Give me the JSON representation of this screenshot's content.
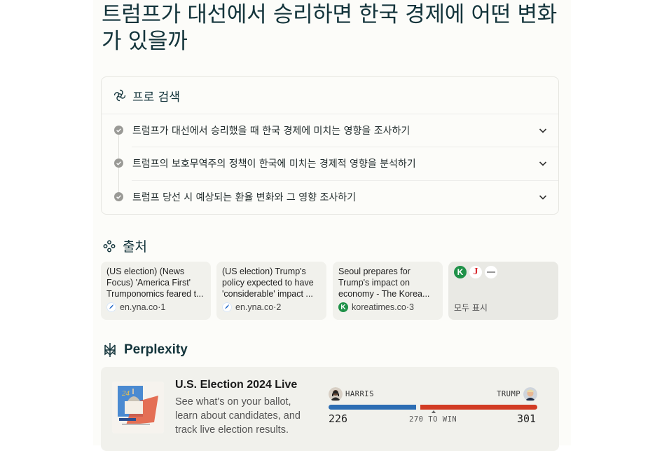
{
  "page": {
    "title": "트럼프가 대선에서 승리하면 한국 경제에 어떤 변화가 있을까"
  },
  "pro_search": {
    "header": "프로 검색",
    "steps": [
      {
        "label": "트럼프가 대선에서 승리했을 때 한국 경제에 미치는 영향을 조사하기"
      },
      {
        "label": "트럼프의 보호무역주의 정책이 한국에 미치는 경제적 영향을 분석하기"
      },
      {
        "label": "트럼프 당선 시 예상되는 환율 변화와 그 영향 조사하기"
      }
    ]
  },
  "sources": {
    "header": "출처",
    "items": [
      {
        "title": "(US election) (News Focus) 'America First' Trumponomics feared t...",
        "domain": "en.yna.co",
        "index": "1",
        "icon": "yna-icon"
      },
      {
        "title": "(US election) Trump's policy expected to have 'considerable' impact ...",
        "domain": "en.yna.co",
        "index": "2",
        "icon": "yna-icon"
      },
      {
        "title": "Seoul prepares for Trump's impact on economy - The Korea...",
        "domain": "koreatimes.co",
        "index": "3",
        "icon": "koreatimes-icon"
      }
    ],
    "show_all": {
      "label": "모두 표시",
      "icons": [
        "koreatimes-icon",
        "joongang-icon",
        "generic-source-icon"
      ],
      "icon_letters": {
        "k": "K",
        "j": "J"
      }
    },
    "meta_separator": " · "
  },
  "perplexity": {
    "header": "Perplexity",
    "election": {
      "title": "U.S. Election 2024 Live",
      "description": "See what's on your ballot, learn about candidates, and track live election results.",
      "harris_label": "HARRIS",
      "trump_label": "TRUMP",
      "harris_votes": "226",
      "trump_votes": "301",
      "to_win": "270 TO WIN",
      "colors": {
        "harris": "#2c6db3",
        "trump": "#d23c24"
      }
    }
  }
}
